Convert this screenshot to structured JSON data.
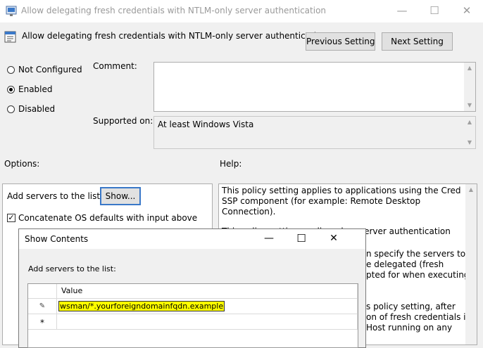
{
  "window": {
    "title": "Allow delegating fresh credentials with NTLM-only server authentication",
    "minimize_glyph": "—",
    "maximize_glyph": "☐",
    "close_glyph": "✕"
  },
  "header": {
    "policy_title": "Allow delegating fresh credentials with NTLM-only server authentication",
    "previous_label": "Previous Setting",
    "next_label": "Next Setting"
  },
  "state": {
    "options": [
      {
        "label": "Not Configured",
        "selected": false
      },
      {
        "label": "Enabled",
        "selected": true
      },
      {
        "label": "Disabled",
        "selected": false
      }
    ]
  },
  "comment": {
    "label": "Comment:",
    "value": ""
  },
  "supported": {
    "label": "Supported on:",
    "value": "At least Windows Vista"
  },
  "options_panel": {
    "heading": "Options:",
    "add_servers_label": "Add servers to the list:",
    "show_button": "Show...",
    "concat_label": "Concatenate OS defaults with input above",
    "concat_checked": true
  },
  "help_panel": {
    "heading": "Help:",
    "paragraphs": [
      "This policy setting applies to applications using the Cred SSP component (for example: Remote Desktop Connection).",
      "This policy setting applies when server authentication was"
    ],
    "fragments": [
      "n specify the servers to",
      "e delegated (fresh",
      "pted for when executing",
      "s policy setting, after",
      "on of fresh credentials is",
      "Host running on any"
    ]
  },
  "show_contents": {
    "title": "Show Contents",
    "list_label": "Add servers to the list:",
    "column_header": "Value",
    "rows": [
      {
        "marker": "✎",
        "value": "wsman/*.yourforeigndomainfqdn.example"
      },
      {
        "marker": "*",
        "value": ""
      }
    ]
  },
  "colors": {
    "selection_highlight": "#ffff00",
    "window_bg": "#f0f0f0",
    "title_inactive_text": "#9a9a9a"
  }
}
